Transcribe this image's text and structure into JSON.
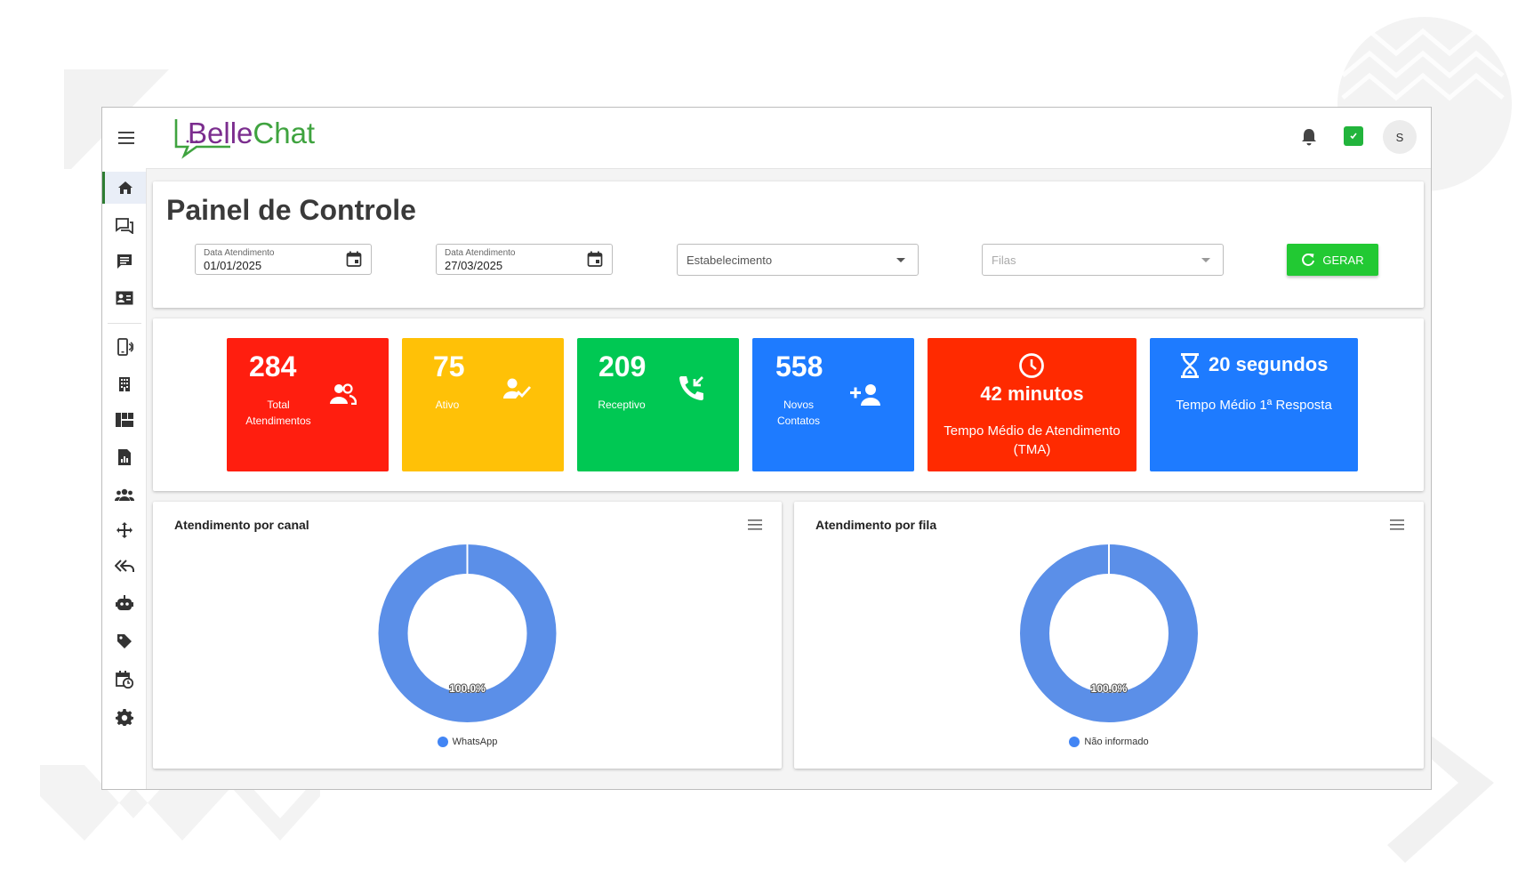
{
  "header": {
    "logo_part1": "Belle",
    "logo_part2": "Chat",
    "avatar_initial": "S"
  },
  "sidebar": {
    "items": [
      {
        "icon": "home-icon",
        "active": true
      },
      {
        "icon": "chats-icon"
      },
      {
        "icon": "message-icon"
      },
      {
        "icon": "contacts-card-icon"
      },
      {
        "icon": "phone-connection-icon"
      },
      {
        "icon": "building-icon"
      },
      {
        "icon": "dashboard-icon"
      },
      {
        "icon": "report-icon"
      },
      {
        "icon": "users-group-icon"
      },
      {
        "icon": "move-icon"
      },
      {
        "icon": "reply-all-icon"
      },
      {
        "icon": "robot-icon"
      },
      {
        "icon": "tag-icon"
      },
      {
        "icon": "calendar-clock-icon"
      },
      {
        "icon": "settings-gear-icon"
      }
    ]
  },
  "filters": {
    "page_title": "Painel de Controle",
    "date_start_label": "Data Atendimento",
    "date_start_value": "01/01/2025",
    "date_end_label": "Data Atendimento",
    "date_end_value": "27/03/2025",
    "establishment_placeholder": "Estabelecimento",
    "queues_placeholder": "Filas",
    "generate_label": "GERAR"
  },
  "stats": [
    {
      "value": "284",
      "label_line1": "Total",
      "label_line2": "Atendimentos",
      "color": "#ff1e0f",
      "icon": "people-icon"
    },
    {
      "value": "75",
      "label_line1": "Ativo",
      "label_line2": "",
      "color": "#ffc107",
      "icon": "person-check-icon"
    },
    {
      "value": "209",
      "label_line1": "Receptivo",
      "label_line2": "",
      "color": "#00c853",
      "icon": "phone-incoming-icon"
    },
    {
      "value": "558",
      "label_line1": "Novos",
      "label_line2": "Contatos",
      "color": "#1e7bff",
      "icon": "person-add-icon"
    },
    {
      "value": "42 minutos",
      "label_line1": "Tempo Médio de Atendimento",
      "label_line2": "(TMA)",
      "color": "#ff2a00",
      "icon": "clock-icon"
    },
    {
      "value": "20 segundos",
      "label_line1": "Tempo Médio 1ª Resposta",
      "label_line2": "",
      "color": "#1e7bff",
      "icon": "hourglass-icon"
    }
  ],
  "chart_data": [
    {
      "type": "pie",
      "title": "Atendimento por canal",
      "categories": [
        "WhatsApp"
      ],
      "values": [
        100.0
      ],
      "labels": [
        "100.0%"
      ],
      "legend": "bottom",
      "colors": [
        "#5b8fe8"
      ]
    },
    {
      "type": "pie",
      "title": "Atendimento por fila",
      "categories": [
        "Não informado"
      ],
      "values": [
        100.0
      ],
      "labels": [
        "100.0%"
      ],
      "legend": "bottom",
      "colors": [
        "#5b8fe8"
      ]
    }
  ]
}
